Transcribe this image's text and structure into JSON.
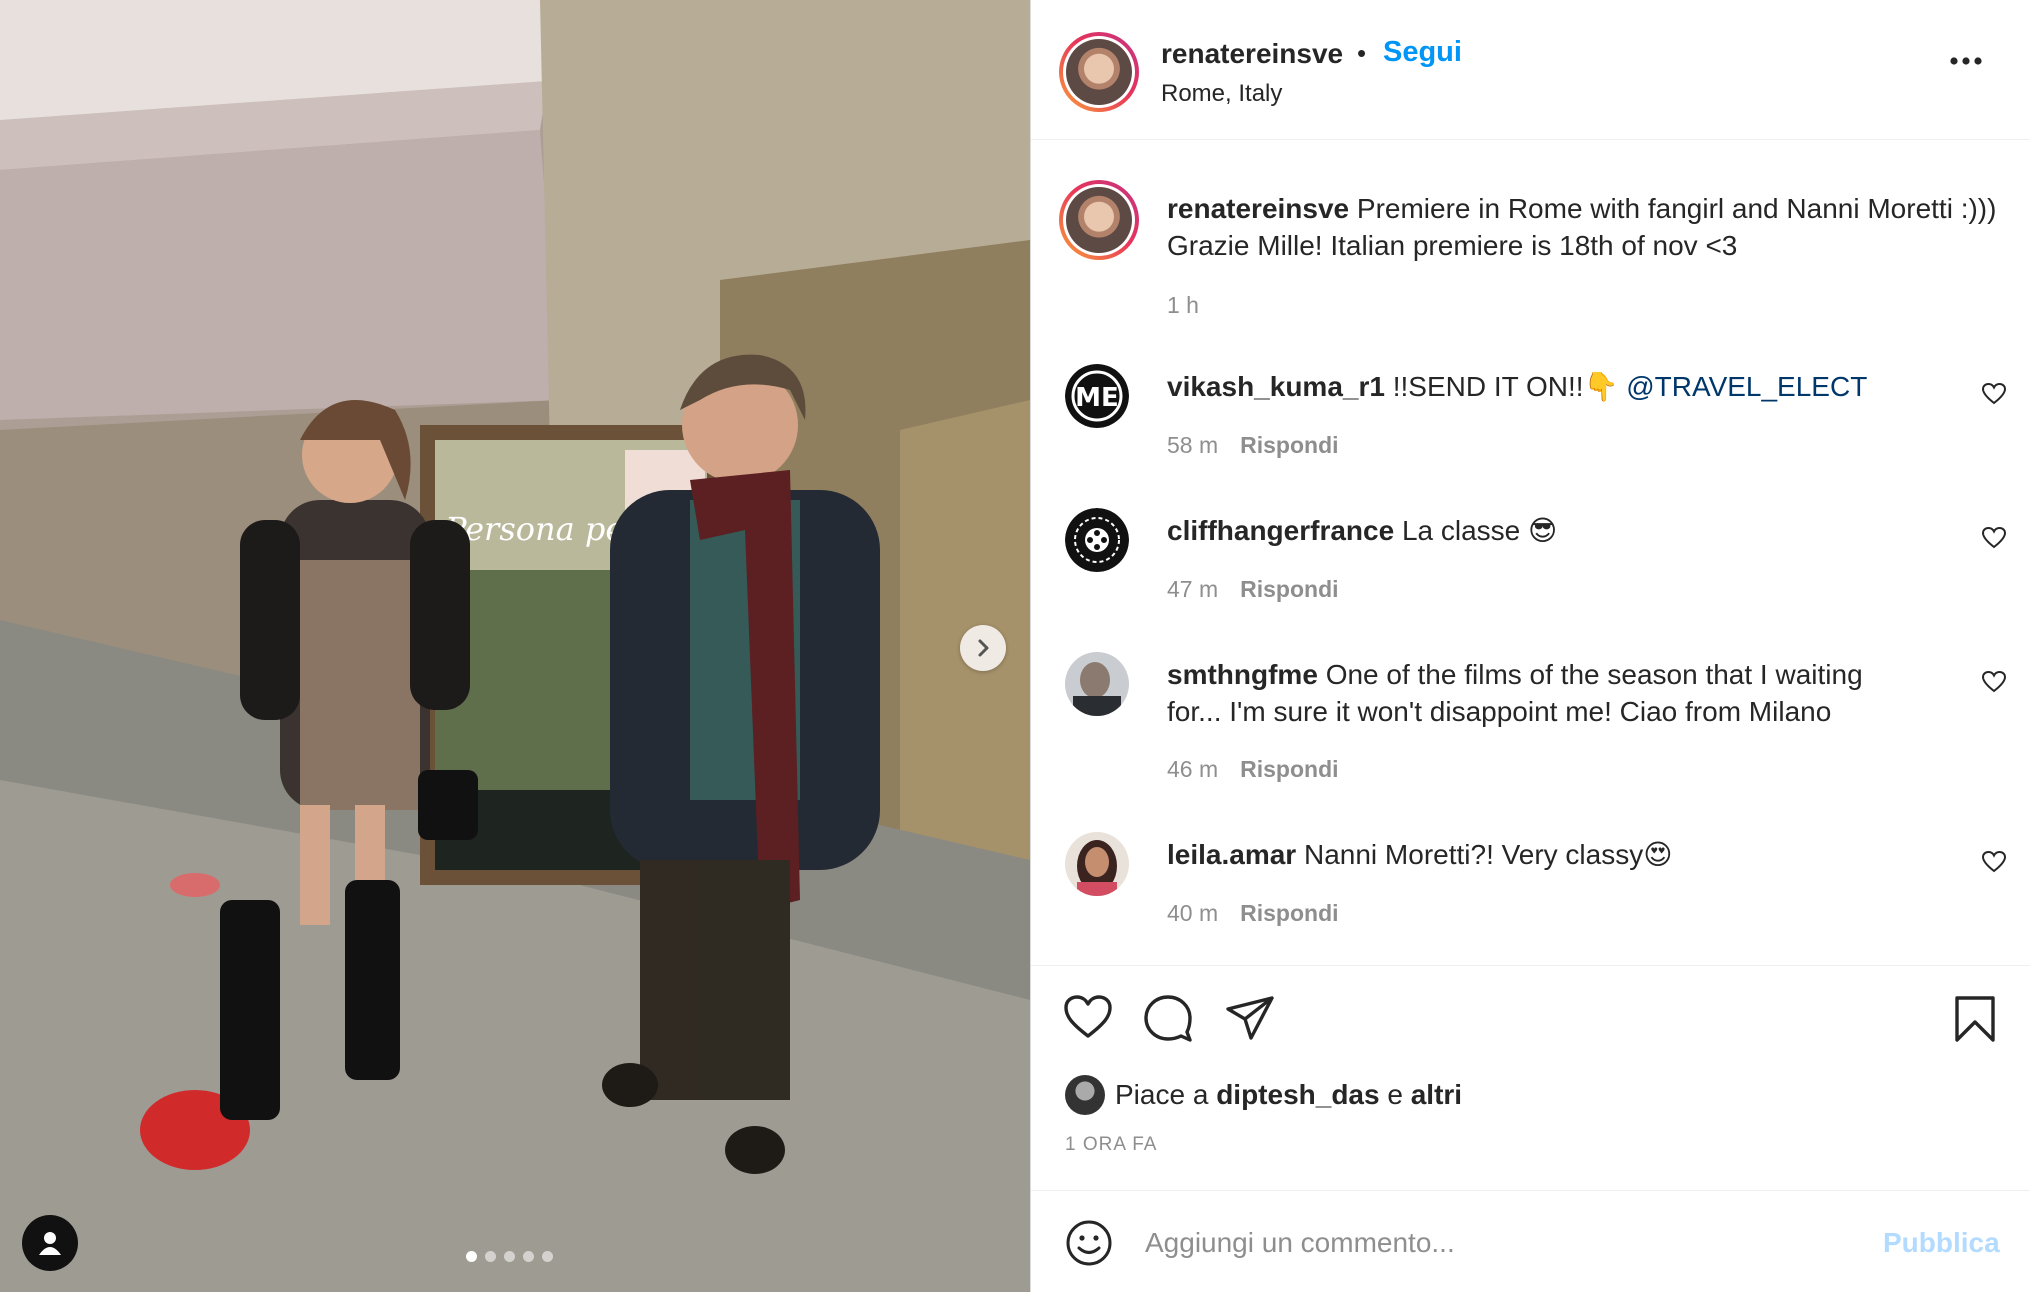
{
  "post": {
    "author": "renatereinsve",
    "follow_label": "Segui",
    "bullet": "•",
    "location": "Rome, Italy",
    "more_icon": "more-horizontal-icon",
    "photo_dots_total": 5,
    "photo_dots_active": 1
  },
  "caption": {
    "username": "renatereinsve",
    "text": "Premiere in Rome with fangirl and Nanni Moretti :))) Grazie Mille! Italian premiere is 18th of nov <3",
    "time": "1 h"
  },
  "comments": [
    {
      "username": "vikash_kuma_r1",
      "text": "!!SEND IT ON!!👇",
      "mention": "@TRAVEL_ELECT",
      "time": "58 m",
      "reply": "Rispondi"
    },
    {
      "username": "cliffhangerfrance",
      "text": "La classe 😎",
      "time": "47 m",
      "reply": "Rispondi"
    },
    {
      "username": "smthngfme",
      "text": "One of the films of the season that I waiting for... I'm sure it won't disappoint me! Ciao from Milano",
      "time": "46 m",
      "reply": "Rispondi"
    },
    {
      "username": "leila.amar",
      "text": "Nanni Moretti?! Very classy😍",
      "time": "40 m",
      "reply": "Rispondi"
    }
  ],
  "likes": {
    "prefix": "Piace a",
    "user": "diptesh_das",
    "conj": "e",
    "others": "altri"
  },
  "posted_ago": "1 ORA FA",
  "composer": {
    "placeholder": "Aggiungi un commento...",
    "publish_label": "Pubblica"
  },
  "colors": {
    "link_blue": "#0095f6",
    "mention_blue": "#00376b",
    "muted": "#8e8e8e",
    "publish_disabled": "#b3dbff"
  }
}
